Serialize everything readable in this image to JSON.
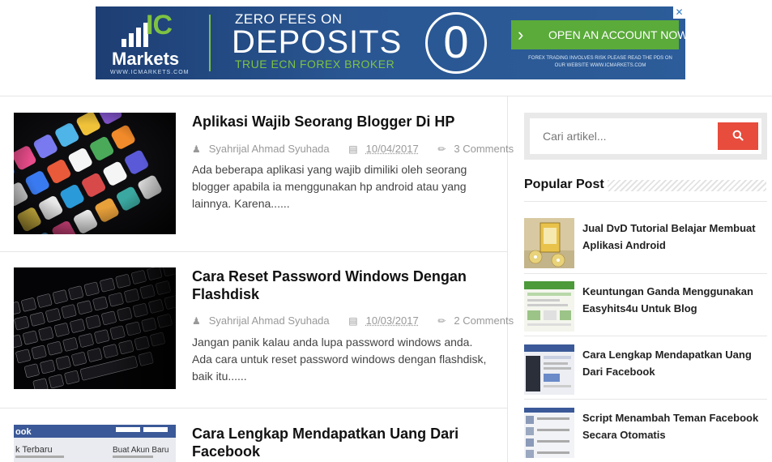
{
  "ad": {
    "close_glyph": "✕",
    "brand_ic": "IC",
    "brand_markets": "Markets",
    "brand_url": "WWW.ICMARKETS.COM",
    "headline_small": "ZERO FEES ON",
    "headline_big": "DEPOSITS",
    "tagline": "TRUE ECN FOREX BROKER",
    "zero": "0",
    "cta_label": "OPEN AN ACCOUNT NOW",
    "cta_chevron": "›",
    "fine_print": "FOREX TRADING INVOLVES RISK PLEASE READ THE PDS ON OUR WEBSITE WWW.ICMARKETS.COM",
    "colors": {
      "brand_green": "#7ec242",
      "brand_blue": "#2a5793"
    }
  },
  "posts": [
    {
      "title": "Aplikasi Wajib Seorang Blogger Di HP",
      "author": "Syahrijal Ahmad Syuhada",
      "date": "10/04/2017",
      "comments": "3 Comments",
      "excerpt": "Ada beberapa aplikasi yang wajib dimiliki oleh seorang blogger apabila ia menggunakan hp android atau yang lainnya. Karena......"
    },
    {
      "title": "Cara Reset Password Windows Dengan Flashdisk",
      "author": "Syahrijal Ahmad Syuhada",
      "date": "10/03/2017",
      "comments": "2 Comments",
      "excerpt": "Jangan panik kalau anda lupa password windows anda. Ada cara untuk reset password windows dengan flashdisk, baik itu......"
    },
    {
      "title": "Cara Lengkap Mendapatkan Uang Dari Facebook",
      "thumb_text_1": "ook",
      "thumb_text_2": "k Terbaru",
      "thumb_text_3": "Buat Akun Baru"
    }
  ],
  "sidebar": {
    "search_placeholder": "Cari artikel...",
    "popular_title": "Popular Post",
    "popular": [
      {
        "title": "Jual DvD Tutorial Belajar Membuat Aplikasi Android"
      },
      {
        "title": "Keuntungan Ganda Menggunakan Easyhits4u Untuk Blog"
      },
      {
        "title": "Cara Lengkap Mendapatkan Uang Dari Facebook"
      },
      {
        "title": "Script Menambah Teman Facebook Secara Otomatis"
      }
    ]
  },
  "icons": {
    "author": "user-icon",
    "date": "calendar-icon",
    "comments": "comments-icon",
    "search": "search-icon"
  }
}
